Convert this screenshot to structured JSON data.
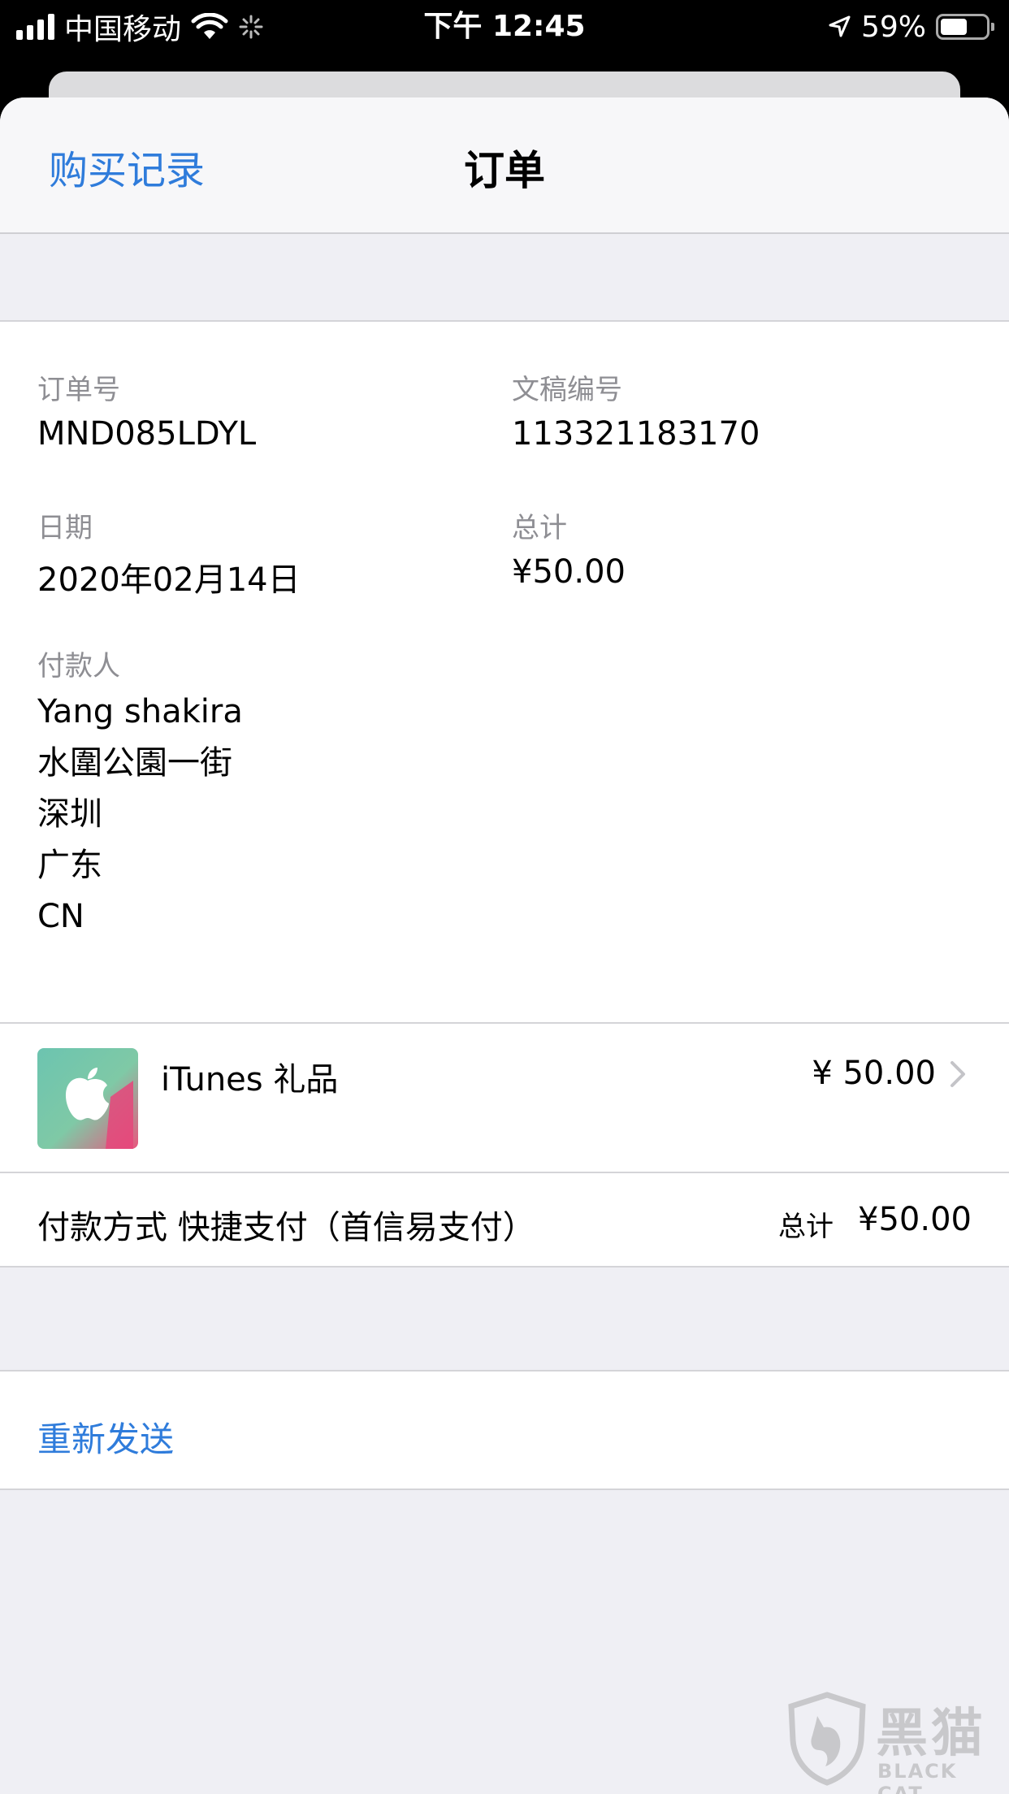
{
  "status_bar": {
    "carrier": "中国移动",
    "time": "下午 12:45",
    "battery_text": "59%",
    "battery_level": 0.59
  },
  "nav": {
    "back_label": "购买记录",
    "title": "订单"
  },
  "order": {
    "order_no_label": "订单号",
    "order_no": "MND085LDYL",
    "doc_no_label": "文稿编号",
    "doc_no": "113321183170",
    "date_label": "日期",
    "date": "2020年02月14日",
    "total_label": "总计",
    "total": "¥50.00",
    "payer_label": "付款人",
    "payer_lines": [
      "Yang shakira",
      "水圍公園一街",
      "深圳",
      "广东",
      "CN"
    ]
  },
  "item": {
    "name": "iTunes 礼品",
    "price": "¥ 50.00",
    "icon": "itunes-gift-card-icon"
  },
  "payment": {
    "method": "付款方式 快捷支付（首信易支付）",
    "total_label": "总计",
    "total": "¥50.00"
  },
  "actions": {
    "resend": "重新发送"
  },
  "watermark": {
    "cn": "黑猫",
    "en": "BLACK CAT"
  },
  "colors": {
    "accent": "#2f7cdb",
    "secondary_text": "#8e8e93",
    "grouped_bg": "#efeff4"
  }
}
